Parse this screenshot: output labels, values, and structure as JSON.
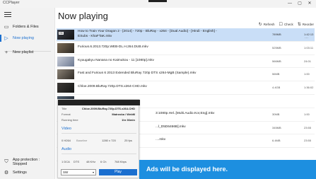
{
  "window": {
    "title": "CCPlayer",
    "minimize": "—",
    "maximize": "▢",
    "close": "✕"
  },
  "sidebar": {
    "items": [
      {
        "label": "Folders & Files",
        "icon": "folder-icon",
        "glyph": "▭"
      },
      {
        "label": "Now playing",
        "icon": "play-icon",
        "glyph": "▷"
      },
      {
        "label": "New playlist",
        "icon": "plus-icon",
        "glyph": "+"
      }
    ],
    "footer": [
      {
        "label": "App protection : Stopped",
        "icon": "shield-icon",
        "glyph": "⛉"
      },
      {
        "label": "Settings",
        "icon": "gear-icon",
        "glyph": "⚙"
      }
    ]
  },
  "main": {
    "title": "Now playing",
    "toolbar": [
      {
        "label": "Refresh",
        "icon": "refresh-icon",
        "glyph": "↻"
      },
      {
        "label": "Check",
        "icon": "check-icon",
        "glyph": "☐"
      },
      {
        "label": "Reorder",
        "icon": "reorder-icon",
        "glyph": "⇅"
      }
    ],
    "rows": [
      {
        "name": "How to Train Your Dragon 2 - [2014] - 720p - BluRay - x264 - [Dual Audio] - [Hindi - English] - ESubs - KhaFTaK.mkv",
        "size": "789MB",
        "duration": "1:42:13",
        "badge": "HD",
        "selected": true
      },
      {
        "name": "Furious.6.2013.720p.WEB-DL.H.264.DUB.mkv",
        "size": "525MB",
        "duration": "1:03:11",
        "badge": "",
        "selected": false
      },
      {
        "name": "Kyuugakyu Nanana no Kaimukou - 11 [1080p].mkv",
        "size": "566MB",
        "duration": "24:01",
        "badge": "",
        "selected": false
      },
      {
        "name": "Fast and Furious 6 2013 Extended BluRay 720p DTS x264-MgB (Sample).mkv",
        "size": "56MB",
        "duration": "1:00",
        "badge": "",
        "selected": false
      },
      {
        "name": "Chloe.2009.BluRay.720p.DTS.x264-CHD.mkv",
        "size": "4.4GB",
        "duration": "1:36:02",
        "badge": "",
        "selected": false
      },
      {
        "name": "",
        "size": "",
        "duration": "",
        "badge": "",
        "selected": false
      },
      {
        "name": "3:1080p.Hel..[Multi.Audio.Kor,Eng].mkv",
        "size": "30MB",
        "duration": "1:00",
        "badge": "",
        "selected": false
      },
      {
        "name": "...l_D5D6466B].mkv",
        "size": "345MB",
        "duration": "23:55",
        "badge": "",
        "selected": false
      },
      {
        "name": "....mkv",
        "size": "6.4MB",
        "duration": "23:55",
        "badge": "",
        "selected": false
      },
      {
        "name": "",
        "size": "",
        "duration": "",
        "badge": "",
        "selected": false
      },
      {
        "name": "",
        "size": "",
        "duration": "",
        "badge": "",
        "selected": false
      }
    ]
  },
  "info": {
    "title_label": "Title",
    "title_value": "Chloe.2009.BluRay.720p.DTS.x264-CHD",
    "format_label": "Format",
    "format_value": "Matroska / WebM",
    "runtime_label": "Running time",
    "runtime_value": "1hr 36min",
    "video_heading": "Video",
    "video_codec": "0  H264",
    "video_profile": "Baseline",
    "video_res": "1280 x 720",
    "video_fps": "25 fps",
    "audio_heading": "Audio",
    "audio_codec": "1  DCA",
    "audio_name": "DTS",
    "audio_rate": "48 KHz",
    "audio_ch": "6 Ch",
    "audio_bitrate": "768 Kbps",
    "decoder_value": "SW",
    "play_label": "Play"
  },
  "ad": {
    "text": "Ads will be displayed here."
  },
  "colors": {
    "accent": "#1b6fcf",
    "ad_bg": "#1d8fe0",
    "selected_row": "#c9def7"
  }
}
